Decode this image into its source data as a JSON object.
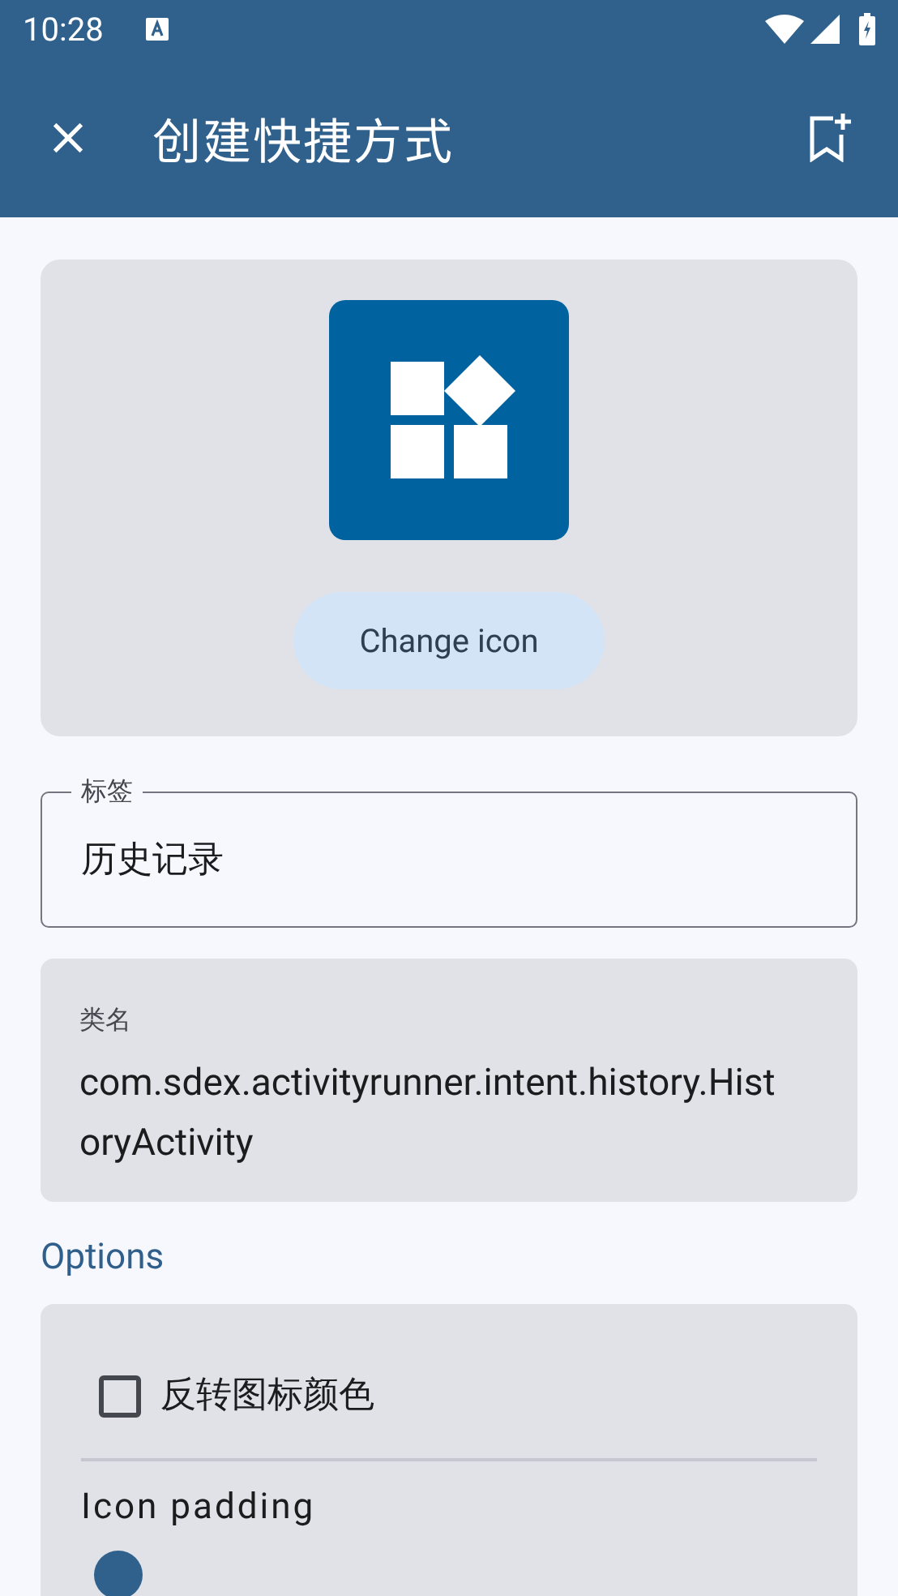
{
  "status_bar": {
    "time": "10:28"
  },
  "app_bar": {
    "title": "创建快捷方式"
  },
  "icon_card": {
    "button": "Change icon"
  },
  "label_field": {
    "label": "标签",
    "value": "历史记录"
  },
  "class_name": {
    "label": "类名",
    "value": "com.sdex.activityrunner.intent.history.HistoryActivity"
  },
  "options": {
    "heading": "Options",
    "invert_colors": {
      "label": "反转图标颜色",
      "checked": false
    },
    "padding": {
      "label": "Icon padding"
    }
  }
}
